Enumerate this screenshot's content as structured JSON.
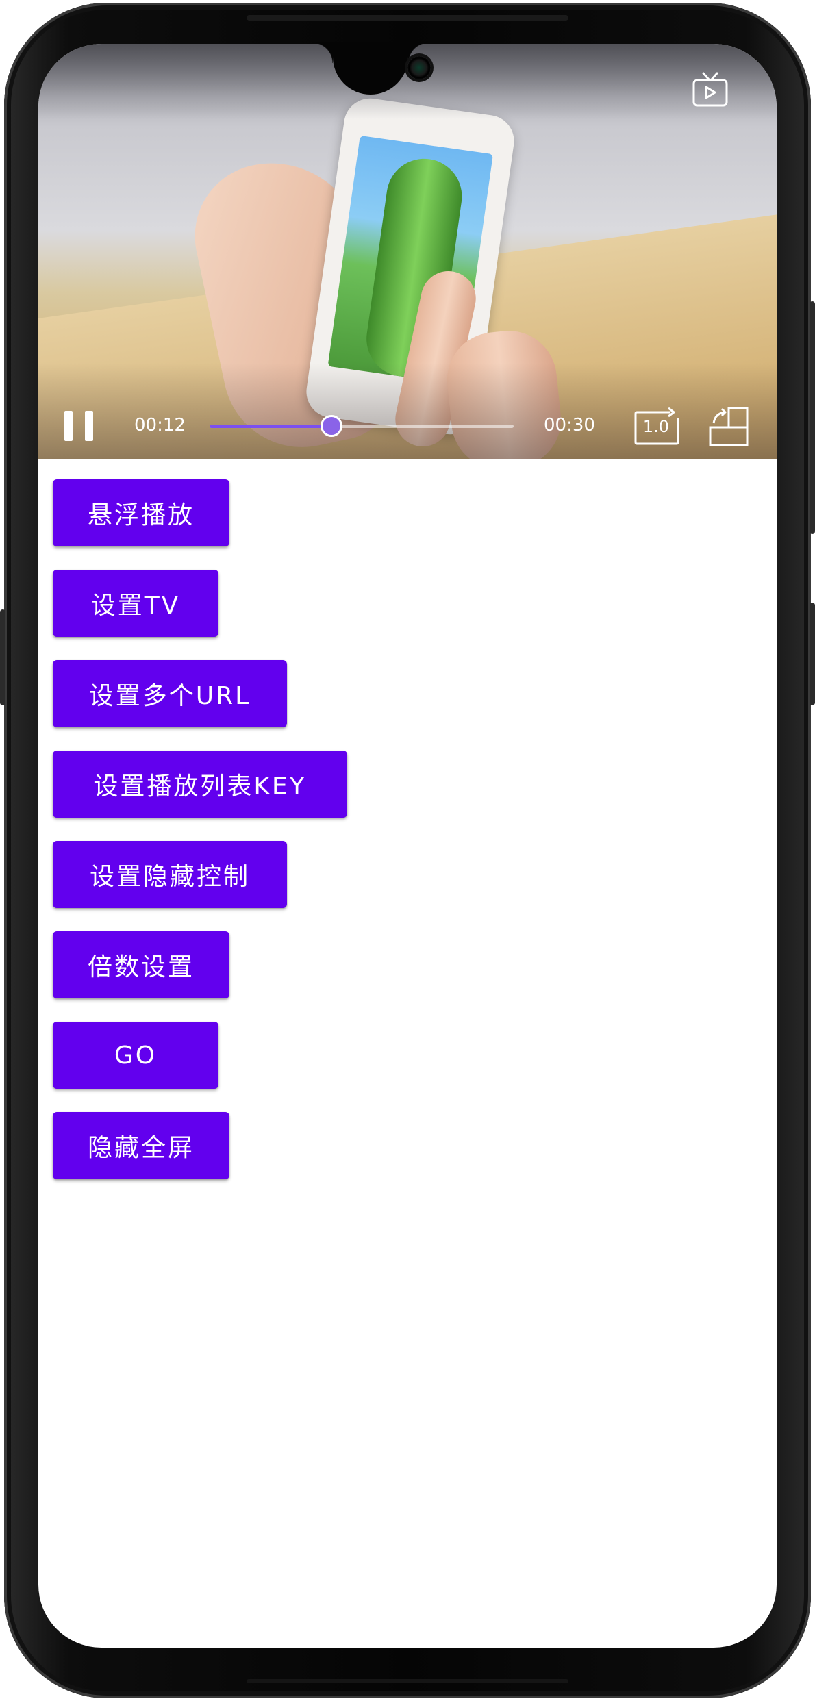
{
  "player": {
    "elapsed_time": "00:12",
    "total_time": "00:30",
    "progress_fraction": 0.4,
    "speed_label": "1.0",
    "accent_color": "#7b4ff0",
    "icons": {
      "tv": "tv-cast-icon",
      "pause": "pause-icon",
      "speed": "playback-speed-icon",
      "rotate": "screen-rotate-icon"
    }
  },
  "buttons": [
    {
      "label": "悬浮播放"
    },
    {
      "label": "设置TV"
    },
    {
      "label": "设置多个URL"
    },
    {
      "label": "设置播放列表KEY"
    },
    {
      "label": "设置隐藏控制"
    },
    {
      "label": "倍数设置"
    },
    {
      "label": "GO"
    },
    {
      "label": "隐藏全屏"
    }
  ],
  "theme": {
    "button_color": "#6200ee",
    "button_text_color": "#ffffff"
  }
}
